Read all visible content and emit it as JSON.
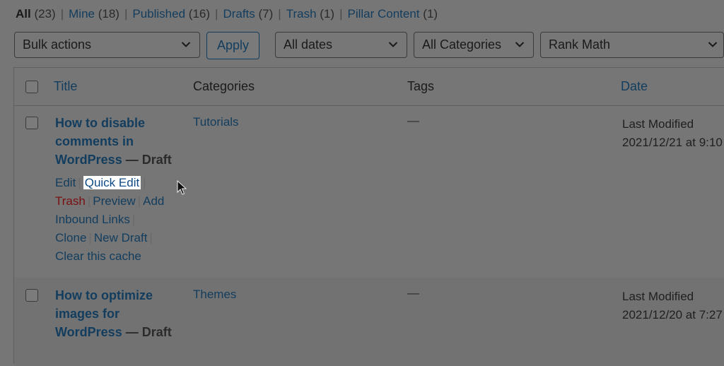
{
  "filters": [
    {
      "label": "All",
      "count": "(23)"
    },
    {
      "label": "Mine",
      "count": "(18)"
    },
    {
      "label": "Published",
      "count": "(16)"
    },
    {
      "label": "Drafts",
      "count": "(7)"
    },
    {
      "label": "Trash",
      "count": "(1)"
    },
    {
      "label": "Pillar Content",
      "count": "(1)"
    }
  ],
  "separator": "|",
  "toolbar": {
    "bulk_actions": "Bulk actions",
    "apply": "Apply",
    "dates": "All dates",
    "categories": "All Categories",
    "seo": "Rank Math"
  },
  "columns": {
    "title": "Title",
    "categories": "Categories",
    "tags": "Tags",
    "date": "Date"
  },
  "posts": [
    {
      "title": "How to disable comments in WordPress",
      "dash": "—",
      "state": "Draft",
      "category": "Tutorials",
      "tags": "—",
      "date_label": "Last Modified",
      "date_value": "2021/12/21 at 9:10",
      "actions": {
        "edit": "Edit",
        "quick_edit": "Quick Edit",
        "trash": "Trash",
        "preview": "Preview",
        "add": "Add",
        "inbound": "Inbound Links",
        "clone": "Clone",
        "new_draft": "New Draft",
        "clear_cache": "Clear this cache"
      }
    },
    {
      "title": "How to optimize images for WordPress",
      "dash": "—",
      "state": "Draft",
      "category": "Themes",
      "tags": "—",
      "date_label": "Last Modified",
      "date_value": "2021/12/20 at 7:27"
    }
  ]
}
